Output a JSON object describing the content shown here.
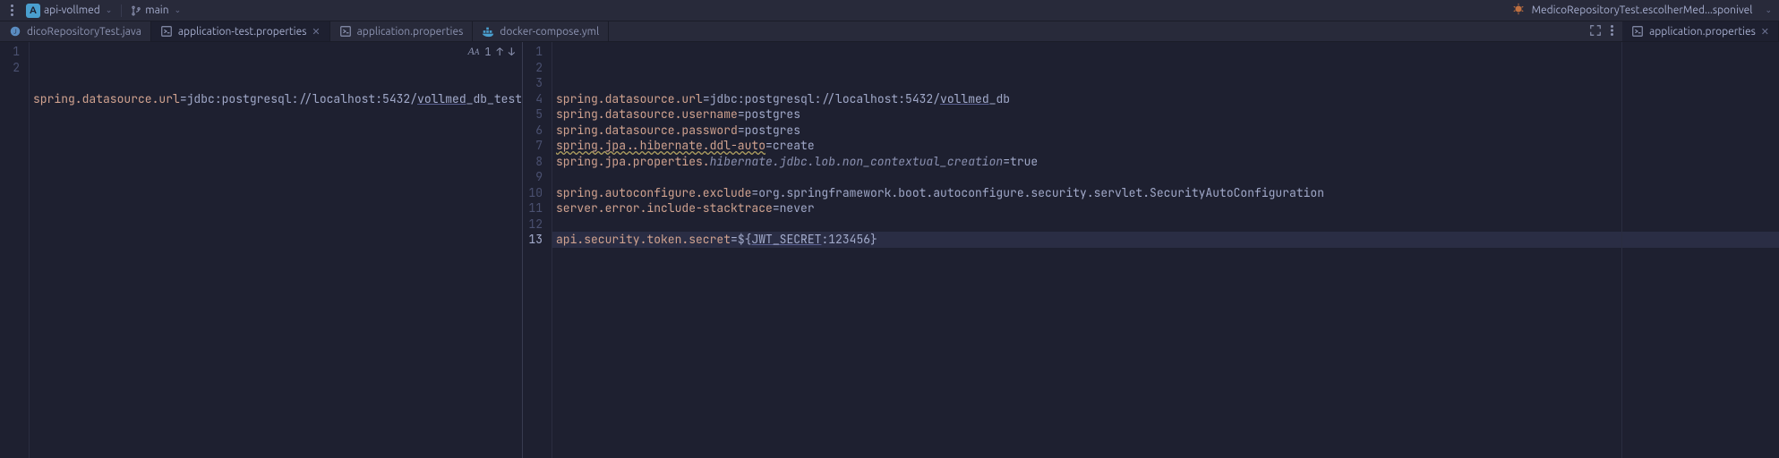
{
  "titlebar": {
    "project_badge": "A",
    "project_name": "api-vollmed",
    "branch_name": "main",
    "run_config": "MedicoRepositoryTest.escolherMed...sponivel"
  },
  "tabs_left": [
    {
      "label": "dicoRepositoryTest.java",
      "icon": "java",
      "active": false,
      "closable": false
    },
    {
      "label": "application-test.properties",
      "icon": "props",
      "active": true,
      "closable": true
    },
    {
      "label": "application.properties",
      "icon": "props",
      "active": false,
      "closable": false
    },
    {
      "label": "docker-compose.yml",
      "icon": "docker",
      "active": false,
      "closable": false
    }
  ],
  "tabs_right": [
    {
      "label": "application.properties",
      "icon": "props",
      "active": true,
      "closable": true
    }
  ],
  "find": {
    "count": "1"
  },
  "editor_left": {
    "lines": [
      {
        "n": 1,
        "key": "spring.datasource.url",
        "val_prefix": "jdbc:postgresql://localhost:5432/",
        "val_link": "vollmed",
        "val_suffix": "_db_test"
      },
      {
        "n": 2,
        "empty": true
      }
    ]
  },
  "editor_right": {
    "active_line": 13,
    "lines": [
      {
        "n": 1,
        "key": "spring.datasource.url",
        "val_prefix": "jdbc:postgresql://localhost:5432/",
        "val_link": "vollmed",
        "val_suffix": "_db"
      },
      {
        "n": 2,
        "key": "spring.datasource.username",
        "val": "postgres"
      },
      {
        "n": 3,
        "key": "spring.datasource.password",
        "val": "postgres"
      },
      {
        "n": 4,
        "key_warn": "spring.jpa..hibernate.ddl-auto",
        "val": "create"
      },
      {
        "n": 5,
        "key": "spring.jpa.properties.",
        "key_italic": "hibernate.jdbc.lob.non_contextual_creation",
        "val": "true"
      },
      {
        "n": 6,
        "empty": true
      },
      {
        "n": 7,
        "key": "spring.autoconfigure.exclude",
        "val": "org.springframework.boot.autoconfigure.security.servlet.SecurityAutoConfiguration"
      },
      {
        "n": 8,
        "key": "server.error.include-stacktrace",
        "val": "never"
      },
      {
        "n": 9,
        "empty": true
      },
      {
        "n": 10,
        "key": "api.security.token.secret",
        "val_prefix": "${",
        "val_link": "JWT_SECRET",
        "val_suffix": ":123456}"
      },
      {
        "n": 11,
        "empty": true
      },
      {
        "n": 12,
        "empty": true
      },
      {
        "n": 13,
        "empty": true,
        "active": true
      }
    ]
  }
}
